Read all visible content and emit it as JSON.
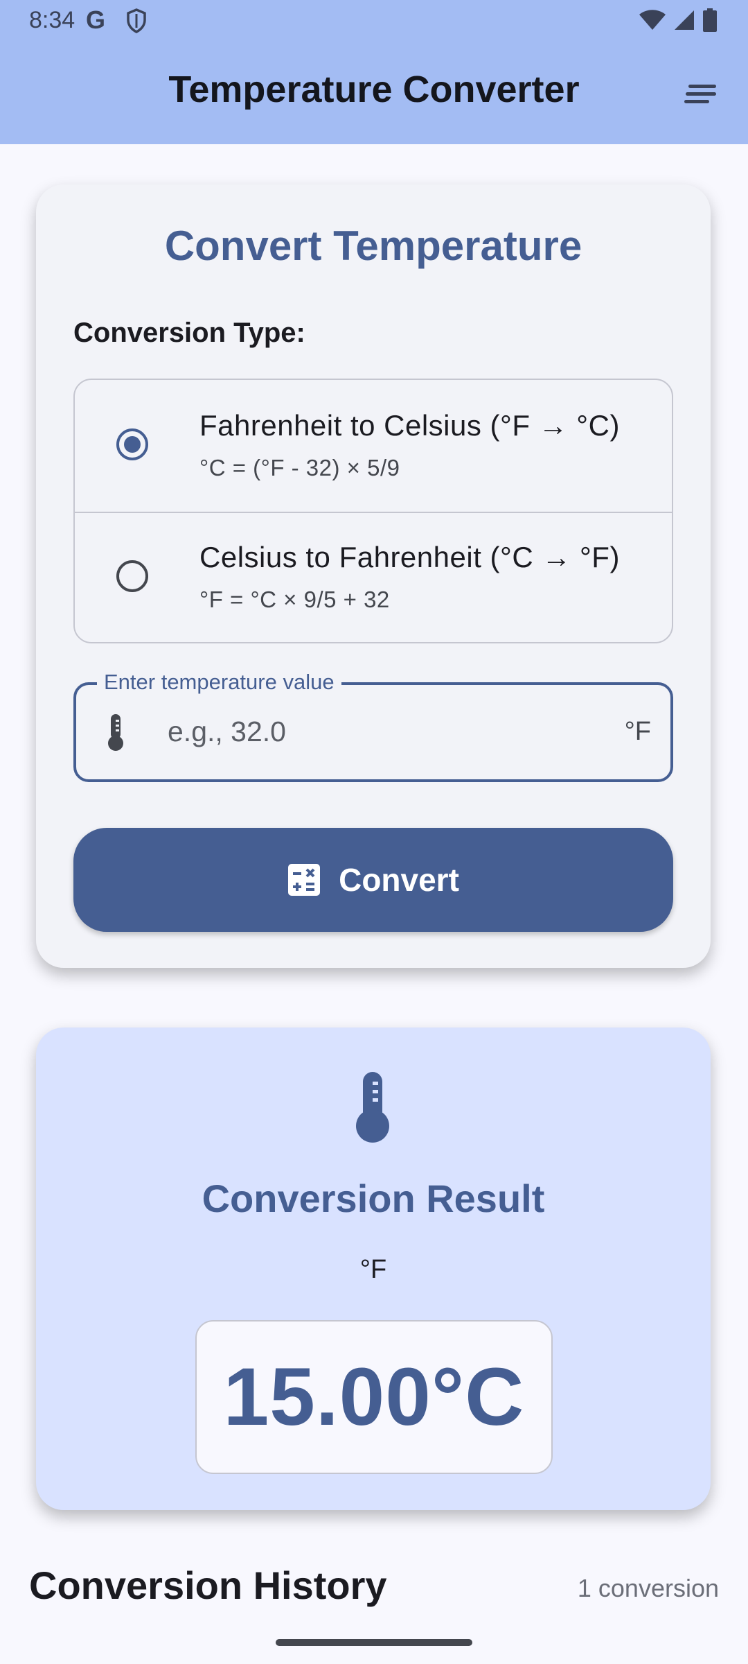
{
  "status_bar": {
    "time": "8:34",
    "g_letter": "G",
    "icons": [
      "google-icon",
      "shield-icon",
      "wifi-icon",
      "signal-icon",
      "battery-icon"
    ]
  },
  "app_bar": {
    "title": "Temperature Converter",
    "menu_icon": "sort-menu-icon"
  },
  "converter": {
    "title": "Convert Temperature",
    "conversion_type_label": "Conversion Type:",
    "options": [
      {
        "label": "Fahrenheit to Celsius (°F → °C)",
        "formula": "°C = (°F - 32) × 5/9",
        "selected": true
      },
      {
        "label": "Celsius to Fahrenheit (°C → °F)",
        "formula": "°F = °C × 9/5 + 32",
        "selected": false
      }
    ],
    "input": {
      "label": "Enter temperature value",
      "placeholder": "e.g., 32.0",
      "value": "",
      "suffix": "°F",
      "icon": "thermometer-icon"
    },
    "convert_button": {
      "label": "Convert",
      "icon": "calculate-icon"
    }
  },
  "result": {
    "icon": "thermometer-icon",
    "title": "Conversion Result",
    "unit_label": "°F",
    "value": "15.00°C"
  },
  "history": {
    "title": "Conversion History",
    "count": "1 conversion"
  },
  "colors": {
    "primary": "#455e92",
    "app_bar": "#a3bcf3",
    "result_bg": "#d9e2ff",
    "card_bg": "#f2f3f8"
  }
}
